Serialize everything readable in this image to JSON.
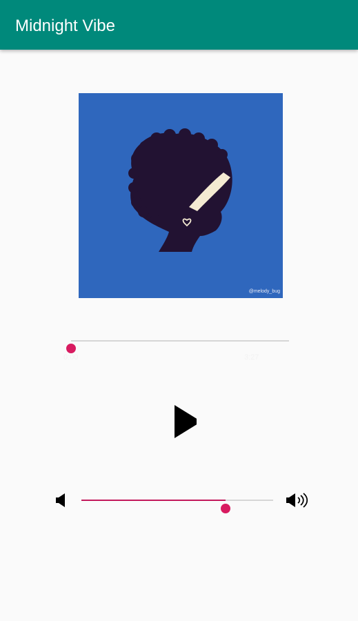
{
  "app_bar": {
    "title": "Midnight Vibe",
    "color": "#00897b"
  },
  "album_art": {
    "credit": "@melody_bug",
    "background_color": "#2f67bd",
    "silhouette_color": "#221232",
    "headband_color": "#f4ead2"
  },
  "player": {
    "progress": {
      "fraction": 0.0,
      "color": "#d81b60",
      "elapsed_label": "0:00",
      "total_label": "3:27"
    },
    "play_icon": "play-icon",
    "volume": {
      "level_fraction": 0.75,
      "color": "#d81b60",
      "low_icon": "volume-low-icon",
      "high_icon": "volume-high-icon"
    }
  }
}
